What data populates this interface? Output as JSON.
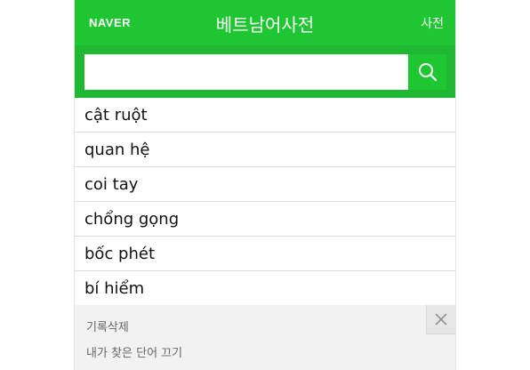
{
  "header": {
    "logo": "NAVER",
    "title": "베트남어사전",
    "dict_link": "사전"
  },
  "search": {
    "value": "",
    "placeholder": ""
  },
  "results": [
    "cật ruột",
    "quan hệ",
    "coi tay",
    "chổng gọng",
    "bốc phét",
    "bí hiểm"
  ],
  "history": {
    "delete_label": "기록삭제",
    "toggle_label": "내가 찾은 단어 끄기"
  },
  "colors": {
    "brand": "#1ec631",
    "search_bar": "#20b832"
  },
  "icons": {
    "search": "search-icon",
    "close": "close-icon"
  }
}
